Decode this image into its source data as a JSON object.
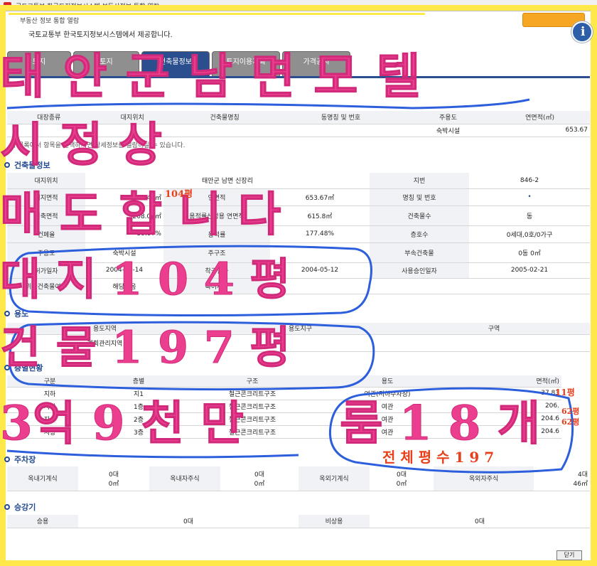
{
  "window": {
    "title": "국토교통부 한국토지정보시스템 부동산정보 통합 열람"
  },
  "header": {
    "title": "부동산 정보 통합 열람",
    "subtitle": "국토교통부 한국토지정보시스템에서 제공합니다.",
    "help_icon": "info-circle-icon"
  },
  "tabs": [
    {
      "label": "토지"
    },
    {
      "label": "토지"
    },
    {
      "label": "건축물정보"
    },
    {
      "label": "토지이용계획"
    },
    {
      "label": "가격공시"
    }
  ],
  "summary": {
    "headers": [
      "대장종류",
      "대지위치",
      "건축물명칭",
      "동명칭 및 번호",
      "주용도",
      "연면적(㎡)"
    ],
    "row": {
      "use": "숙박시설",
      "area": "653.67"
    },
    "note": "위 목록에서 항목을 선택하시면 상세정보를 열람하실 수 있습니다."
  },
  "building": {
    "section": "건축물정보",
    "rows": [
      [
        "대지위치",
        "",
        "태안군 남면 신장리",
        "",
        "지번",
        "846-2"
      ],
      [
        "대지면적",
        "347㎡",
        "연면적",
        "653.67㎡",
        "명칭 및 번호",
        "•"
      ],
      [
        "건축면적",
        "208.08㎡",
        "용적률산정용 연면적",
        "615.8㎡",
        "건축물수",
        "동"
      ],
      [
        "건폐율",
        "59.97%",
        "용적률",
        "177.48%",
        "층호수",
        "0세대,0호/0가구"
      ],
      [
        "주용도",
        "숙박시설",
        "주구조",
        "",
        "부속건축물",
        "0동 0㎡"
      ],
      [
        "허가일자",
        "2004-05-14",
        "착공일자",
        "2004-05-12",
        "사용승인일자",
        "2005-02-21"
      ],
      [
        "위반건축물여부",
        "해당없음",
        "특이사항",
        "",
        "",
        ""
      ]
    ]
  },
  "usage": {
    "section": "용도",
    "headers": [
      "용도지역",
      "용도지구",
      "구역"
    ],
    "row": [
      "계획관리지역",
      "",
      ""
    ]
  },
  "floors": {
    "section": "층별현황",
    "headers": [
      "구분",
      "층별",
      "구조",
      "용도",
      "면적(㎡)"
    ],
    "rows": [
      [
        "지하",
        "지1",
        "철근콘크리트구조",
        "여관(지하주차장)",
        "37.83"
      ],
      [
        "지상",
        "1층",
        "철근콘크리트구조",
        "여관",
        "206."
      ],
      [
        "지상",
        "2층",
        "철근콘크리트구조",
        "여관",
        "204.6"
      ],
      [
        "지상",
        "3층",
        "철근콘크리트구조",
        "여관",
        "204.6"
      ]
    ]
  },
  "parking": {
    "section": "주차장",
    "cells": [
      [
        "옥내기계식",
        "0대",
        "0㎡"
      ],
      [
        "옥내자주식",
        "0대",
        "0㎡"
      ],
      [
        "옥외기계식",
        "0대",
        "0㎡"
      ],
      [
        "옥외자주식",
        "4대",
        "46㎡"
      ]
    ]
  },
  "elevator": {
    "section": "승강기",
    "cells": [
      "승용",
      "0대",
      "비상용",
      "0대"
    ]
  },
  "footer": {
    "close_label": "닫기"
  },
  "overlay": {
    "line1": "태 안 군  남 면 모 텔",
    "line2": "시 정 상",
    "line3": "매 도 합 니 다",
    "line4": "대 지 1 0 4 평",
    "line5": "건 물 1 9 7 평",
    "line6": "3억 9 천 만",
    "line7": "룸 1 8 개",
    "red_pyeong": "104평",
    "red_total": "전 체 평 수 1 9 7",
    "red_11": "11평",
    "red_62a": "62평",
    "red_62b": "62평"
  },
  "colors": {
    "overlay_pink": "#ec3e8f",
    "overlay_blue": "#2d5fdc",
    "frame_yellow": "#ffe94a",
    "tab_active": "#2b4f8e"
  }
}
